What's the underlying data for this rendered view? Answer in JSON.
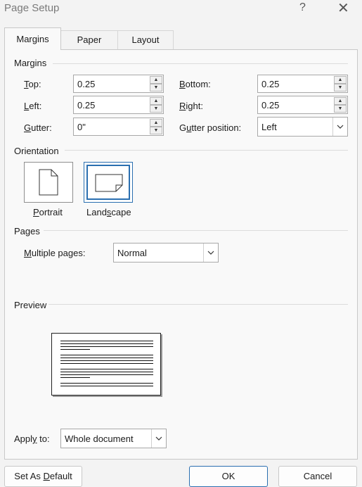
{
  "window": {
    "title": "Page Setup",
    "help_glyph": "?",
    "close_glyph": "✕"
  },
  "tabs": [
    {
      "label": "Margins",
      "active": true
    },
    {
      "label": "Paper",
      "active": false
    },
    {
      "label": "Layout",
      "active": false
    }
  ],
  "margins": {
    "section": "Margins",
    "top": {
      "prefix": "",
      "accel": "T",
      "rest": "op:",
      "value": "0.25"
    },
    "left": {
      "prefix": "",
      "accel": "L",
      "rest": "eft:",
      "value": "0.25"
    },
    "gutter": {
      "prefix": "",
      "accel": "G",
      "rest": "utter:",
      "value": "0\""
    },
    "bottom": {
      "prefix": "",
      "accel": "B",
      "rest": "ottom:",
      "value": "0.25"
    },
    "right": {
      "prefix": "",
      "accel": "R",
      "rest": "ight:",
      "value": "0.25"
    },
    "gutter_position": {
      "prefix": "G",
      "accel": "u",
      "rest": "tter position:",
      "value": "Left"
    }
  },
  "orientation": {
    "section": "Orientation",
    "portrait": {
      "prefix": "",
      "accel": "P",
      "rest": "ortrait",
      "selected": false
    },
    "landscape": {
      "prefix": "Land",
      "accel": "s",
      "rest": "cape",
      "selected": true
    }
  },
  "pages": {
    "section": "Pages",
    "multiple": {
      "prefix": "",
      "accel": "M",
      "rest": "ultiple pages:",
      "value": "Normal"
    }
  },
  "preview": {
    "section": "Preview"
  },
  "apply": {
    "prefix": "Appl",
    "accel": "y",
    "rest": " to:",
    "value": "Whole document"
  },
  "buttons": {
    "default": {
      "prefix": "Set As ",
      "accel": "D",
      "rest": "efault"
    },
    "ok": "OK",
    "cancel": "Cancel"
  },
  "colors": {
    "accent": "#2a6fb0",
    "panel": "#f9f9f9",
    "background": "#f3f3f3"
  }
}
